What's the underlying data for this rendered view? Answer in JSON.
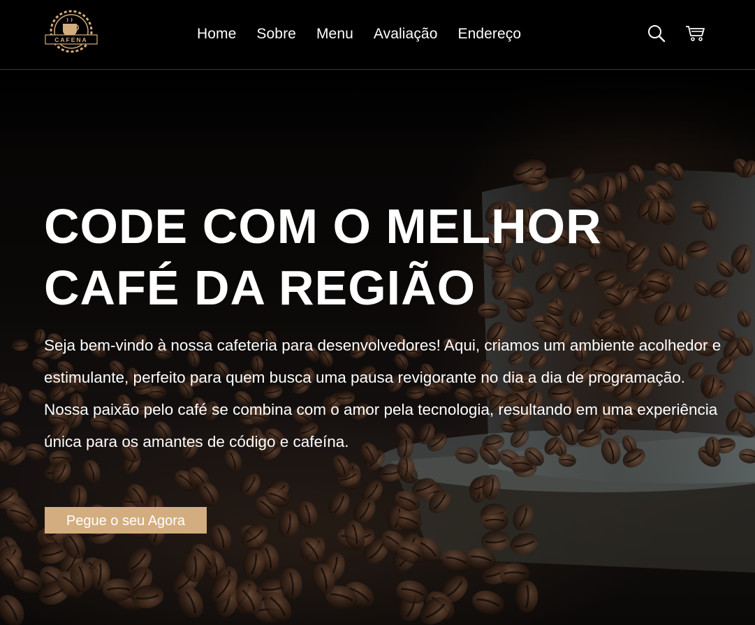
{
  "brand": {
    "logo_text": "CAFENA",
    "accent_color": "#d3ad7f"
  },
  "nav": {
    "items": [
      {
        "label": "Home"
      },
      {
        "label": "Sobre"
      },
      {
        "label": "Menu"
      },
      {
        "label": "Avaliação"
      },
      {
        "label": "Endereço"
      }
    ]
  },
  "header_icons": {
    "search": "search-icon",
    "cart": "cart-icon"
  },
  "hero": {
    "title_line1": "CODE COM O MELHOR",
    "title_line2": "CAFÉ DA REGIÃO",
    "description": "Seja bem-vindo à nossa cafeteria para desenvolvedores! Aqui, criamos um ambiente acolhedor e estimulante, perfeito para quem busca uma pausa revigorante no dia a dia de programação. Nossa paixão pelo café se combina com o amor pela tecnologia, resultando em uma experiência única para os amantes de código e cafeína.",
    "cta_label": "Pegue o seu Agora"
  }
}
